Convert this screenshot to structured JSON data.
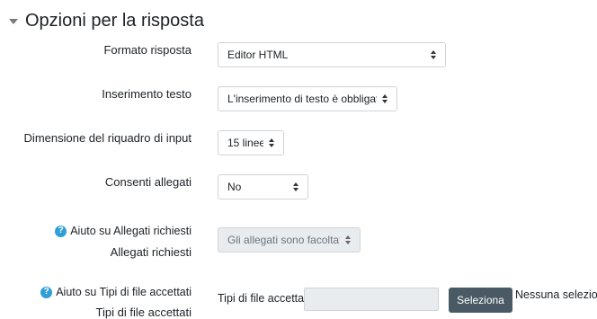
{
  "section": {
    "title": "Opzioni per la risposta"
  },
  "fields": {
    "formato": {
      "label": "Formato risposta",
      "value": "Editor HTML"
    },
    "inserimento": {
      "label": "Inserimento testo",
      "value": "L'inserimento di testo è obbligatorio"
    },
    "dimensione": {
      "label": "Dimensione del riquadro di input",
      "value": "15 linee"
    },
    "allegati": {
      "label": "Consenti allegati",
      "value": "No"
    },
    "allegati_richiesti": {
      "help": "Aiuto su Allegati richiesti",
      "label": "Allegati richiesti",
      "value": "Gli allegati sono facoltativi"
    },
    "tipi_file": {
      "help": "Aiuto su Tipi di file accettati",
      "label": "Tipi di file accettati",
      "inline_label": "Tipi di file accettati",
      "button": "Seleziona",
      "status": "Nessuna selezione"
    }
  }
}
